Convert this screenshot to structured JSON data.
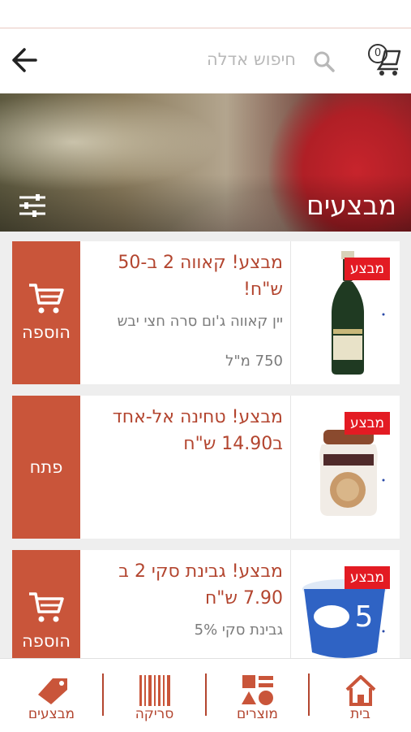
{
  "header": {
    "search_placeholder": "חיפוש אדלה",
    "cart_count": "0"
  },
  "hero": {
    "title": "מבצעים"
  },
  "products": [
    {
      "title": "מבצע! קאווה 2 ב-50 ש\"ח!",
      "subtitle": "יין קאווה ג'ום סרה חצי יבש",
      "size": "750 מ\"ל",
      "badge": "מבצע",
      "action": "הוספה",
      "image": "wine-bottle"
    },
    {
      "title": "מבצע! טחינה אל-אחד ב14.90 ש\"ח",
      "subtitle": "",
      "size": "",
      "badge": "מבצע",
      "action": "פתח",
      "image": "tahini-jar"
    },
    {
      "title": "מבצע! גבינת סקי 2 ב 7.90 ש\"ח",
      "subtitle": "גבינת סקי 5%",
      "size": "",
      "badge": "מבצע",
      "action": "הוספה",
      "image": "cheese-cup"
    }
  ],
  "nav": [
    {
      "label": "מבצעים",
      "icon": "sale-tag-icon"
    },
    {
      "label": "סריקה",
      "icon": "barcode-icon"
    },
    {
      "label": "מוצרים",
      "icon": "shapes-icon"
    },
    {
      "label": "בית",
      "icon": "home-icon"
    }
  ],
  "colors": {
    "accent": "#c9553a",
    "badge": "#e31b23",
    "title": "#b3452f"
  }
}
